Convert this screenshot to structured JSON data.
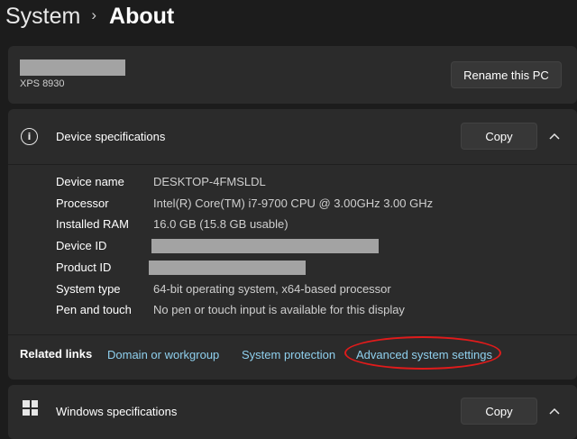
{
  "breadcrumb": {
    "parent": "System",
    "separator": "›",
    "current": "About"
  },
  "pc": {
    "model": "XPS 8930",
    "rename_label": "Rename this PC"
  },
  "device_specs": {
    "title": "Device specifications",
    "copy_label": "Copy",
    "rows": [
      {
        "label": "Device name",
        "value": "DESKTOP-4FMSLDL"
      },
      {
        "label": "Processor",
        "value": "Intel(R) Core(TM) i7-9700 CPU @ 3.00GHz   3.00 GHz"
      },
      {
        "label": "Installed RAM",
        "value": "16.0 GB (15.8 GB usable)"
      },
      {
        "label": "Device ID",
        "value": ""
      },
      {
        "label": "Product ID",
        "value": ""
      },
      {
        "label": "System type",
        "value": "64-bit operating system, x64-based processor"
      },
      {
        "label": "Pen and touch",
        "value": "No pen or touch input is available for this display"
      }
    ]
  },
  "related_links": {
    "title": "Related links",
    "links": [
      "Domain or workgroup",
      "System protection",
      "Advanced system settings"
    ]
  },
  "windows_specs": {
    "title": "Windows specifications",
    "copy_label": "Copy"
  },
  "colors": {
    "background": "#1c1c1c",
    "card": "#2b2b2b",
    "link": "#8fd0ee",
    "highlight": "#e01b1b"
  },
  "icons": [
    "info-icon",
    "chevron-up-icon",
    "windows-logo-icon"
  ]
}
